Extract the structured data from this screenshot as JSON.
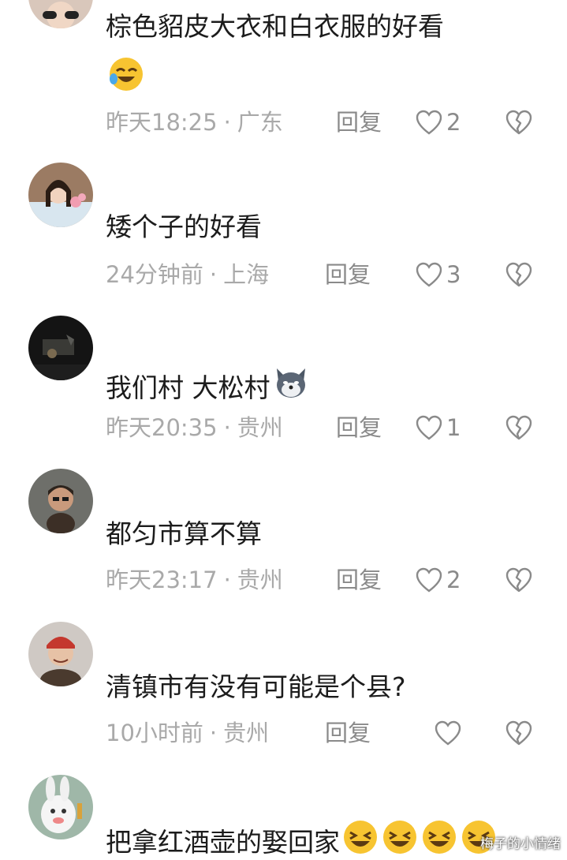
{
  "comments": [
    {
      "text": "棕色貂皮大衣和白衣服的好看",
      "emoji": "😂",
      "time": "昨天18:25",
      "dot": "·",
      "location": "广东",
      "reply": "回复",
      "likes": "2"
    },
    {
      "text": "矮个子的好看",
      "time": "24分钟前",
      "dot": "·",
      "location": "上海",
      "reply": "回复",
      "likes": "3"
    },
    {
      "text": "我们村 大松村",
      "emoji": "dog-face",
      "time": "昨天20:35",
      "dot": "·",
      "location": "贵州",
      "reply": "回复",
      "likes": "1"
    },
    {
      "text": "都匀市算不算",
      "time": "昨天23:17",
      "dot": "·",
      "location": "贵州",
      "reply": "回复",
      "likes": "2"
    },
    {
      "text": "清镇市有没有可能是个县?",
      "time": "10小时前",
      "dot": "·",
      "location": "贵州",
      "reply": "回复",
      "likes": ""
    },
    {
      "text": "把拿红酒壶的娶回家",
      "emoji": "laughing x4"
    }
  ],
  "watermark": "梅子的小情绪",
  "colors": {
    "text": "#1c1c1c",
    "meta": "#a9a9a9",
    "icon": "#8a8a8a",
    "background": "#ffffff"
  }
}
